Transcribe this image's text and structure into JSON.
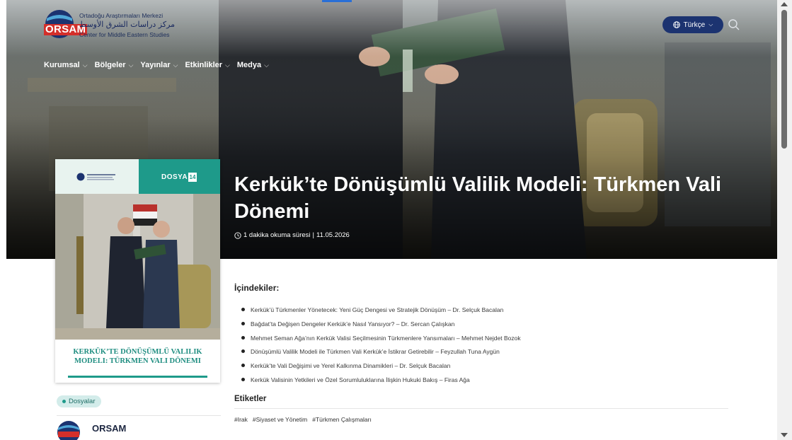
{
  "header": {
    "logo": {
      "line1": "Ortadoğu Araştırmaları Merkezi",
      "arabic": "مركز دراسات الشرق الأوسط",
      "line3": "Center for Middle Eastern Studies",
      "mark": "ORSAM"
    },
    "nav": [
      {
        "label": "Kurumsal"
      },
      {
        "label": "Bölgeler"
      },
      {
        "label": "Yayınlar"
      },
      {
        "label": "Etkinlikler"
      },
      {
        "label": "Medya"
      }
    ],
    "language_label": "Türkçe",
    "icons": {
      "language": "globe-icon",
      "search": "search-icon",
      "chevron": "chevron-down-icon"
    }
  },
  "article": {
    "title": "Kerkük’te Dönüşümlü Valilik Modeli: Türkmen Vali Dönemi",
    "reading_time": "1 dakika okuma süresi",
    "date": "11.05.2026",
    "separator": "|"
  },
  "cover": {
    "series_label": "DOSYA",
    "series_number": "14",
    "title_line1": "KERKÜK’TE DÖNÜŞÜMLÜ VALILIK",
    "title_line2": "MODELI: TÜRKMEN VALI DÖNEMI"
  },
  "sidebar": {
    "category_badge": "Dosyalar",
    "author_name": "ORSAM"
  },
  "toc": {
    "heading": "İçindekiler:",
    "items": [
      "Kerkük’ü Türkmenler Yönetecek: Yeni Güç Dengesi ve Stratejik Dönüşüm – Dr. Selçuk Bacalan",
      "Bağdat’ta Değişen Dengeler Kerkük’e Nasıl Yansıyor? – Dr. Sercan Çalışkan",
      "Mehmet Seman Ağa’nın Kerkük Valisi Seçilmesinin Türkmenlere Yansımaları – Mehmet Nejdet Bozok",
      "Dönüşümlü Valilik Modeli ile Türkmen Vali Kerkük’e İstikrar Getirebilir – Feyzullah Tuna Aygün",
      "Kerkük’te Vali Değişimi ve Yerel Kalkınma Dinamikleri – Dr. Selçuk Bacalan",
      "Kerkük Valisinin Yetkileri ve Özel Sorumluluklarına İlişkin Hukuki Bakış – Firas Ağa"
    ]
  },
  "tags": {
    "heading": "Etiketler",
    "items": [
      "#Irak",
      "#Siyaset ve Yönetim",
      "#Türkmen Çalışmaları"
    ]
  },
  "colors": {
    "brand_navy": "#1c3370",
    "brand_red": "#d42f2a",
    "teal": "#1e9a8a"
  }
}
